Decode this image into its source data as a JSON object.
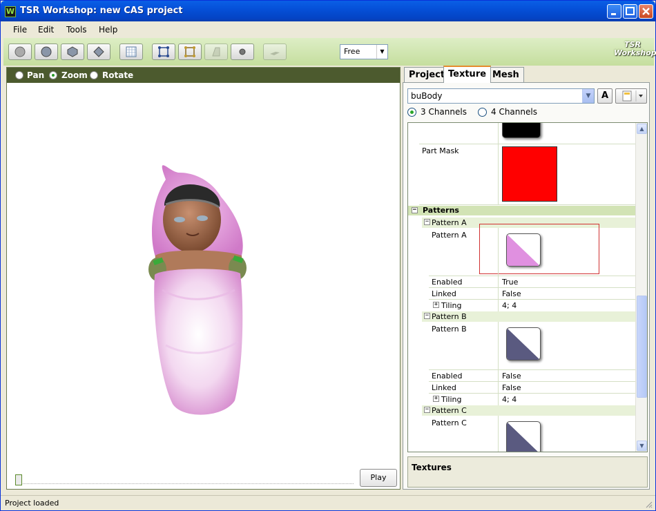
{
  "window": {
    "title": "TSR Workshop: new CAS project",
    "app_icon": "W"
  },
  "menu": [
    "File",
    "Edit",
    "Tools",
    "Help"
  ],
  "toolbar": {
    "mode_select": "Free",
    "logo_line1": "TSR",
    "logo_line2": "Workshop"
  },
  "viewport": {
    "modes": [
      {
        "label": "Pan",
        "selected": false
      },
      {
        "label": "Zoom",
        "selected": true
      },
      {
        "label": "Rotate",
        "selected": false
      }
    ],
    "play_label": "Play"
  },
  "tabs": [
    {
      "label": "Project",
      "active": false
    },
    {
      "label": "Texture",
      "active": true
    },
    {
      "label": "Mesh",
      "active": false
    }
  ],
  "texture": {
    "selected_texture": "buBody",
    "a_label": "A",
    "channels": [
      {
        "label": "3 Channels",
        "selected": true
      },
      {
        "label": "4 Channels",
        "selected": false
      }
    ],
    "part_mask_label": "Part Mask",
    "patterns_label": "Patterns",
    "pattern_a": {
      "header": "Pattern A",
      "label": "Pattern A",
      "enabled_label": "Enabled",
      "enabled": "True",
      "linked_label": "Linked",
      "linked": "False",
      "tiling_label": "Tiling",
      "tiling": "4; 4",
      "color": "#e090e0"
    },
    "pattern_b": {
      "header": "Pattern B",
      "label": "Pattern B",
      "enabled_label": "Enabled",
      "enabled": "False",
      "linked_label": "Linked",
      "linked": "False",
      "tiling_label": "Tiling",
      "tiling": "4; 4",
      "color": "#5a5a80"
    },
    "pattern_c": {
      "header": "Pattern C",
      "label": "Pattern C",
      "color": "#5a5a80"
    },
    "help_title": "Textures"
  },
  "status": "Project loaded"
}
